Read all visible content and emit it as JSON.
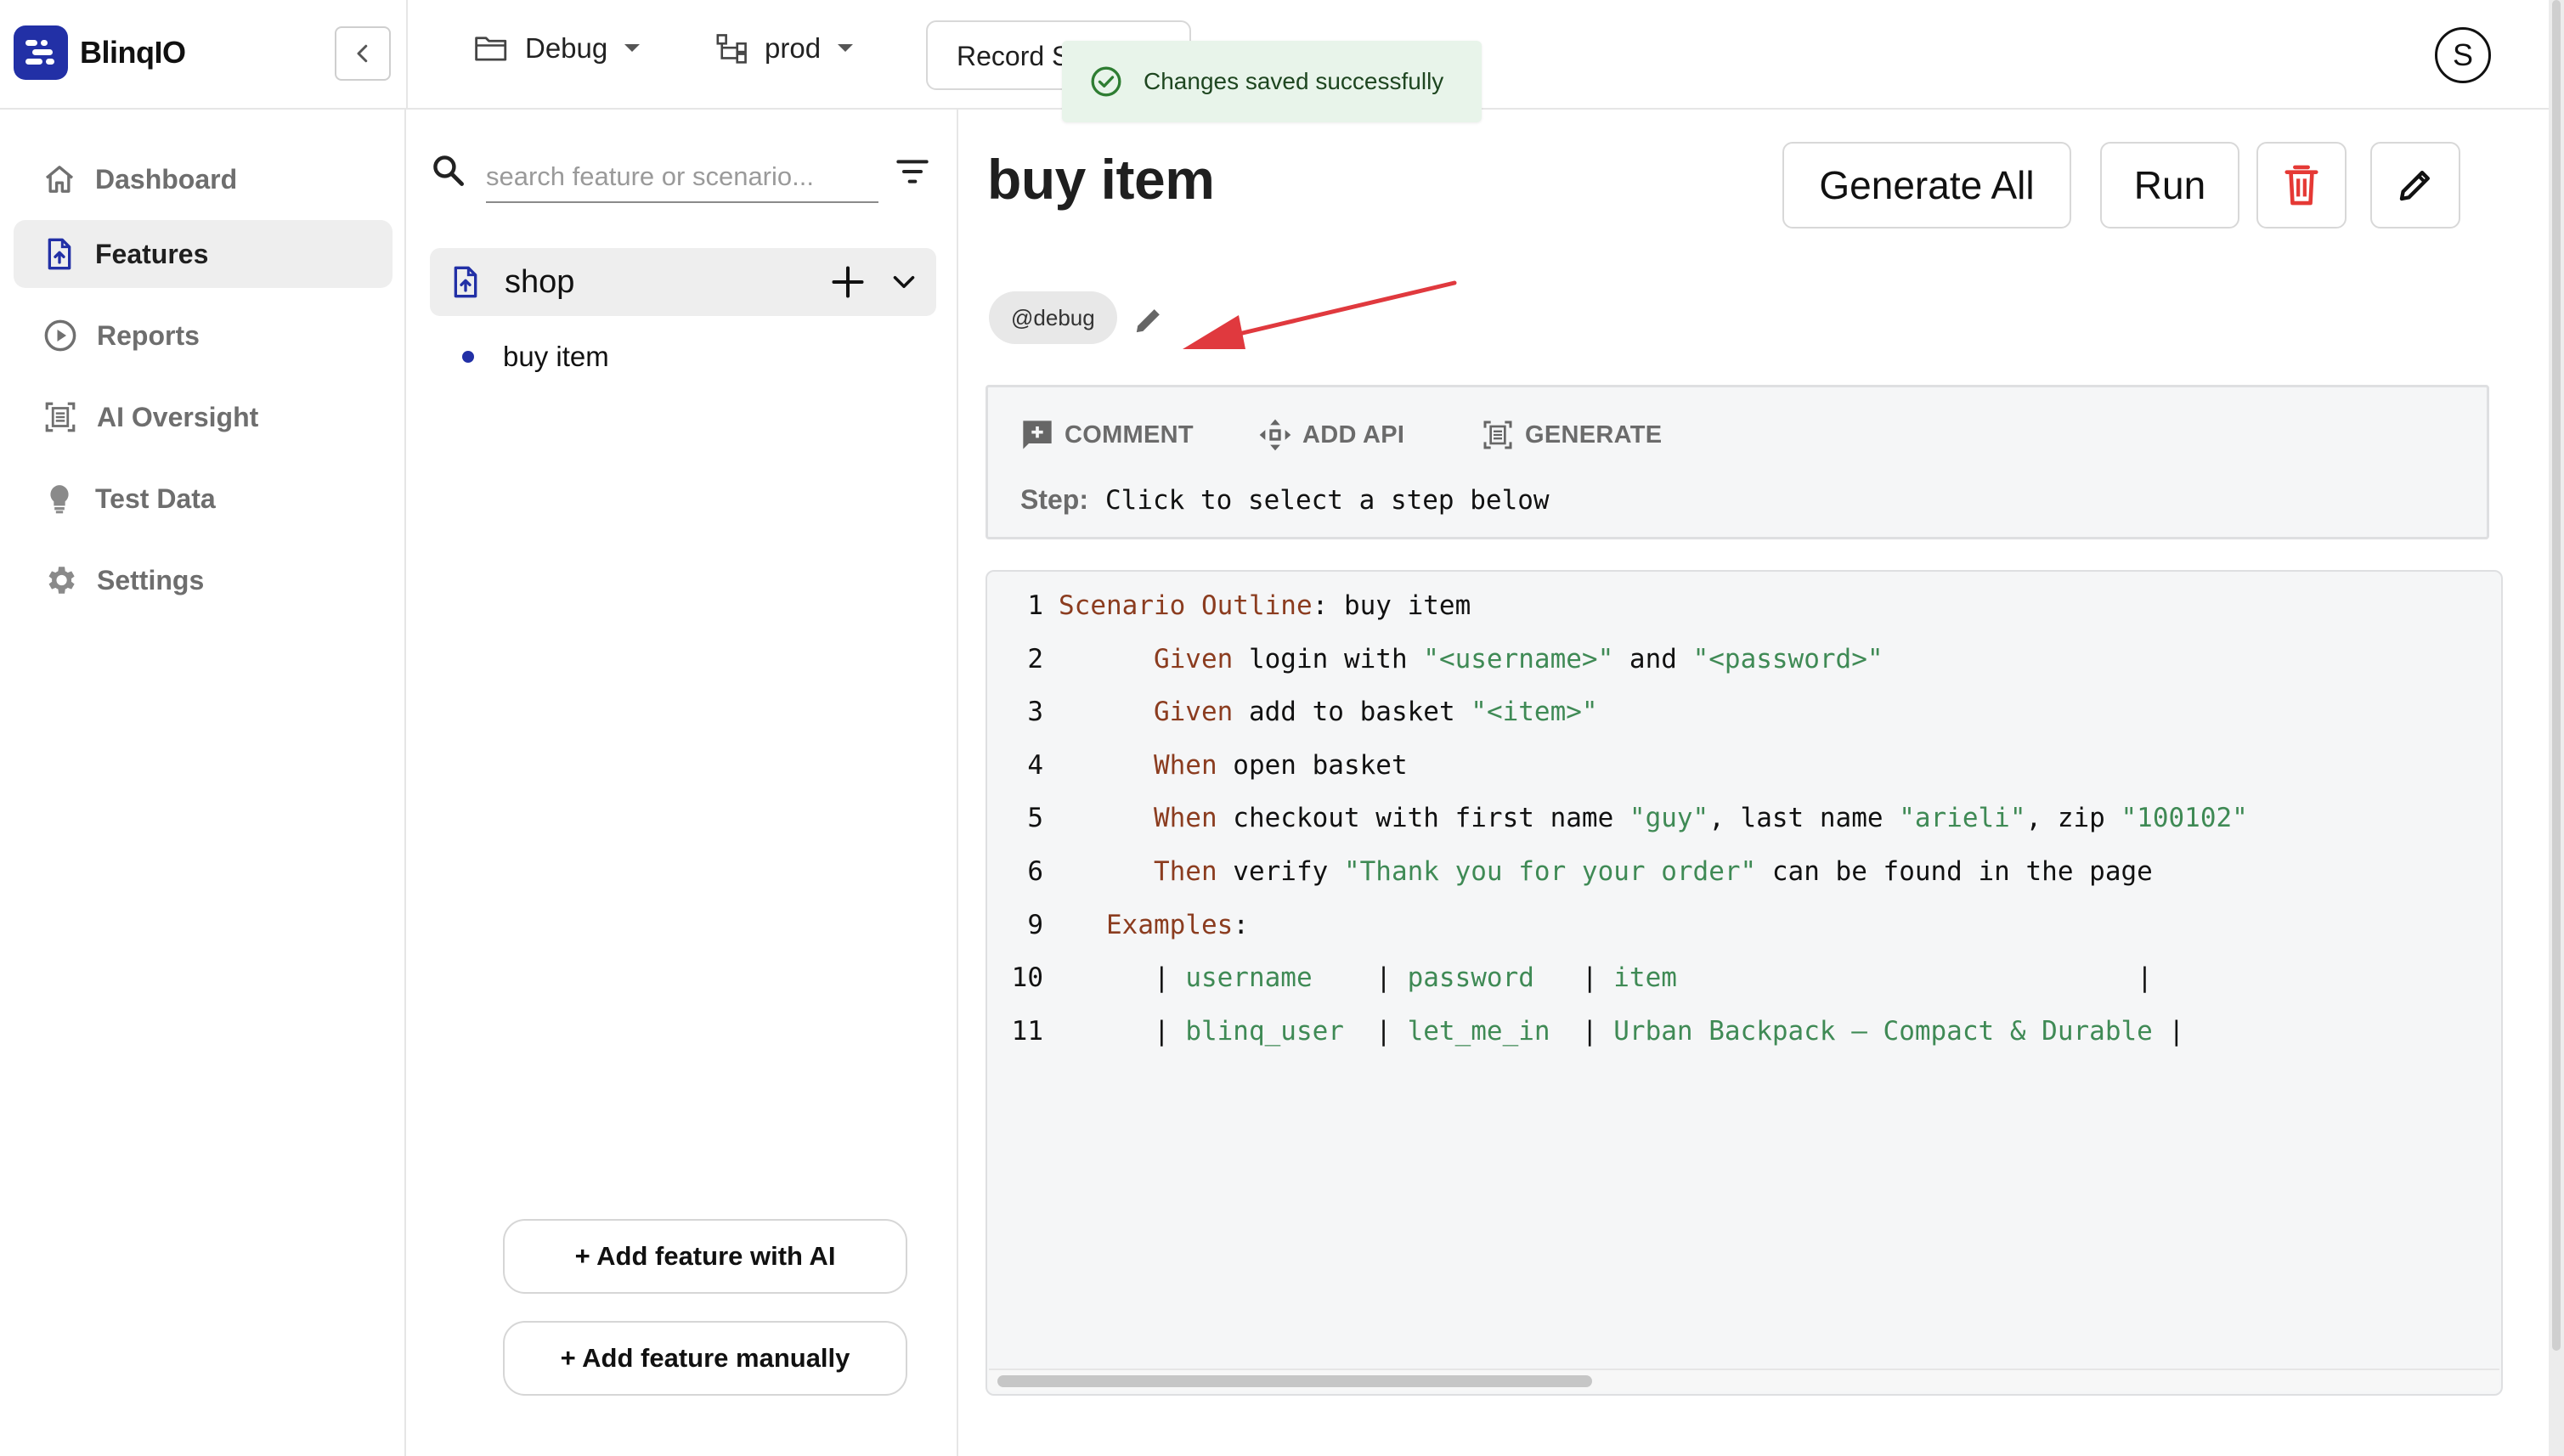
{
  "app": {
    "name": "BlinqIO"
  },
  "topbar": {
    "project": "Debug",
    "environment": "prod",
    "record_button": "Record S",
    "toast": "Changes saved successfully",
    "avatar_initial": "S"
  },
  "sidebar": {
    "items": [
      {
        "label": "Dashboard",
        "icon": "home-icon",
        "active": false
      },
      {
        "label": "Features",
        "icon": "feature-file-icon",
        "active": true
      },
      {
        "label": "Reports",
        "icon": "play-circle-icon",
        "active": false
      },
      {
        "label": "AI Oversight",
        "icon": "scan-document-icon",
        "active": false
      },
      {
        "label": "Test Data",
        "icon": "lightbulb-icon",
        "active": false
      },
      {
        "label": "Settings",
        "icon": "gear-icon",
        "active": false
      }
    ]
  },
  "features_panel": {
    "search_placeholder": "search feature or scenario...",
    "feature_name": "shop",
    "scenarios": [
      "buy item"
    ],
    "add_ai_button": "+ Add feature with AI",
    "add_manual_button": "+ Add feature manually"
  },
  "main": {
    "title": "buy item",
    "generate_all_button": "Generate All",
    "run_button": "Run",
    "tag": "@debug",
    "toolbar": {
      "comment": "COMMENT",
      "add_api": "ADD API",
      "generate": "GENERATE"
    },
    "step_label": "Step:",
    "step_value": "Click to select a step below"
  },
  "code": {
    "lines": [
      {
        "num": "1",
        "text": "Scenario Outline: buy item"
      },
      {
        "num": "2",
        "text": "      Given login with \"<username>\" and \"<password>\""
      },
      {
        "num": "3",
        "text": "      Given add to basket \"<item>\""
      },
      {
        "num": "4",
        "text": "      When open basket"
      },
      {
        "num": "5",
        "text": "      When checkout with first name \"guy\", last name \"arieli\", zip \"100102\""
      },
      {
        "num": "6",
        "text": "      Then verify \"Thank you for your order\" can be found in the page"
      },
      {
        "num": "9",
        "text": "   Examples:"
      },
      {
        "num": "10",
        "text": "      | username    | password   | item                             |"
      },
      {
        "num": "11",
        "text": "      | blinq_user  | let_me_in  | Urban Backpack – Compact & Durable |"
      }
    ]
  },
  "colors": {
    "brand": "#2230a6",
    "keyword": "#8b3c1f",
    "string": "#3f8a55",
    "delete": "#e53935",
    "toast_bg": "#e8f4ea",
    "arrow": "#e0393e"
  }
}
